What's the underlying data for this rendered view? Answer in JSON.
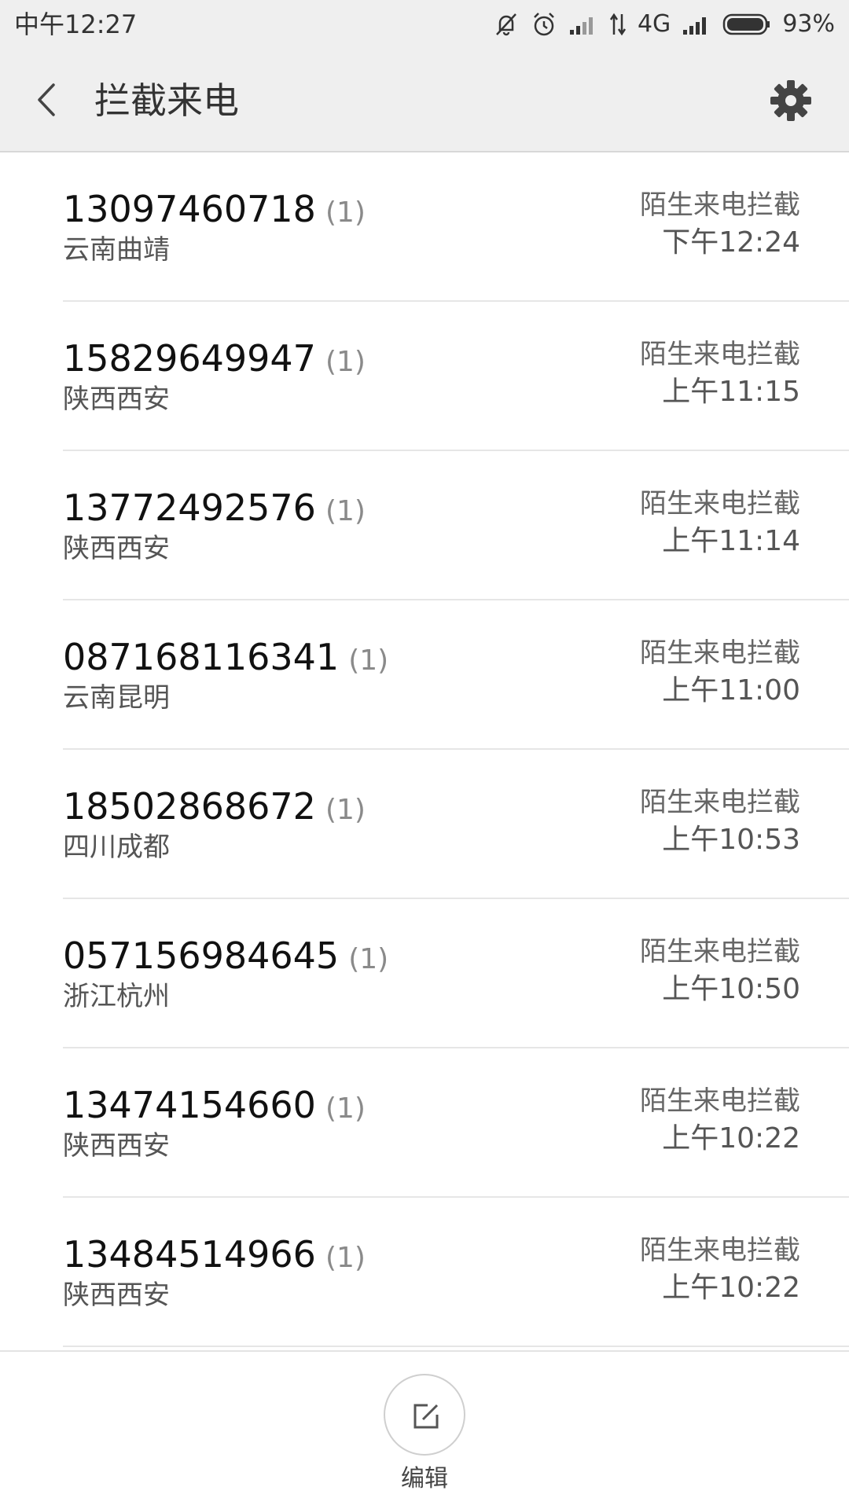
{
  "status_bar": {
    "time": "中午12:27",
    "network": "4G",
    "battery": "93%",
    "icons": [
      "mute-icon",
      "alarm-icon",
      "signal-icon",
      "data-arrows-icon",
      "signal-icon",
      "battery-icon"
    ]
  },
  "header": {
    "title": "拦截来电",
    "back_icon": "chevron-left-icon",
    "settings_icon": "gear-icon"
  },
  "calls": [
    {
      "number": "13097460718",
      "count": "(1)",
      "location": "云南曲靖",
      "type": "陌生来电拦截",
      "time": "下午12:24"
    },
    {
      "number": "15829649947",
      "count": "(1)",
      "location": "陕西西安",
      "type": "陌生来电拦截",
      "time": "上午11:15"
    },
    {
      "number": "13772492576",
      "count": "(1)",
      "location": "陕西西安",
      "type": "陌生来电拦截",
      "time": "上午11:14"
    },
    {
      "number": "087168116341",
      "count": "(1)",
      "location": "云南昆明",
      "type": "陌生来电拦截",
      "time": "上午11:00"
    },
    {
      "number": "18502868672",
      "count": "(1)",
      "location": "四川成都",
      "type": "陌生来电拦截",
      "time": "上午10:53"
    },
    {
      "number": "057156984645",
      "count": "(1)",
      "location": "浙江杭州",
      "type": "陌生来电拦截",
      "time": "上午10:50"
    },
    {
      "number": "13474154660",
      "count": "(1)",
      "location": "陕西西安",
      "type": "陌生来电拦截",
      "time": "上午10:22"
    },
    {
      "number": "13484514966",
      "count": "(1)",
      "location": "陕西西安",
      "type": "陌生来电拦截",
      "time": "上午10:22"
    }
  ],
  "bottom": {
    "edit_label": "编辑",
    "edit_icon": "edit-icon"
  },
  "colors": {
    "header_bg": "#efefef",
    "text_primary": "#111111",
    "text_secondary": "#666666",
    "divider": "#e6e6e6"
  }
}
